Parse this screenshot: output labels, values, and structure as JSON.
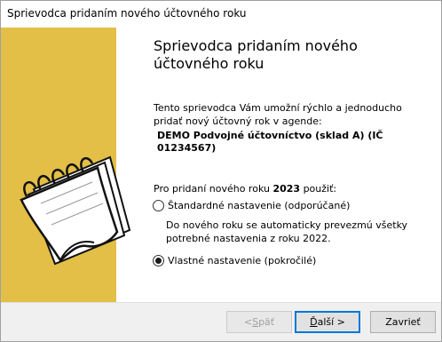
{
  "window": {
    "title": "Sprievodca pridaním nového účtovného roku"
  },
  "icons": {
    "illustration": "notebook-illustration"
  },
  "colors": {
    "side_panel": "#e3bf47",
    "default_button_border": "#0078d7"
  },
  "main": {
    "heading": "Sprievodca pridaním nového účtovného roku",
    "intro": "Tento sprievodca Vám umožní rýchlo a jednoducho pridať nový účtovný rok v agende:",
    "agenda_name": "DEMO Podvojné účtovníctvo (sklad A) (IČ 01234567)",
    "year_prefix": "Pro pridaní nového roku",
    "year": "2023",
    "year_suffix": "použiť:",
    "option_standard": {
      "label": "Štandardné nastavenie (odporúčané)",
      "selected": false
    },
    "option_standard_desc": "Do nového roku se automaticky prevezmú všetky potrebné nastavenia z roku 2022.",
    "option_custom": {
      "label": "Vlastné nastavenie (pokročilé)",
      "selected": true
    }
  },
  "buttons": {
    "back_prefix": "< ",
    "back_key": "S",
    "back_rest": "päť",
    "next_key": "Ď",
    "next_rest": "alší >",
    "close": "Zavrieť"
  }
}
